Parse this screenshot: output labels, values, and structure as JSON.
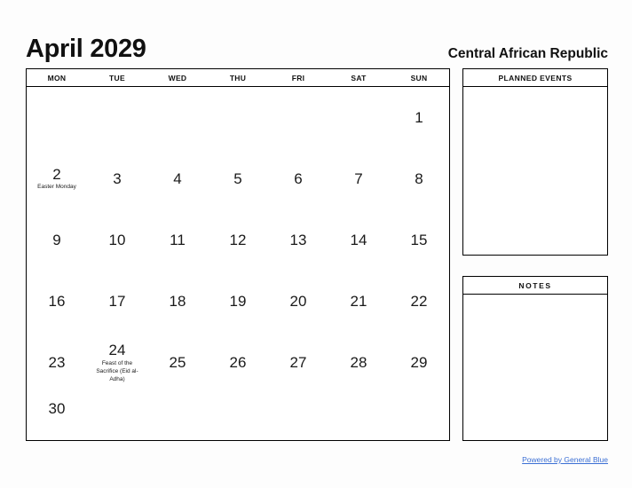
{
  "header": {
    "month_title": "April 2029",
    "region_title": "Central African Republic"
  },
  "calendar": {
    "weekdays": [
      "MON",
      "TUE",
      "WED",
      "THU",
      "FRI",
      "SAT",
      "SUN"
    ],
    "weeks": [
      [
        {
          "day": "",
          "event": ""
        },
        {
          "day": "",
          "event": ""
        },
        {
          "day": "",
          "event": ""
        },
        {
          "day": "",
          "event": ""
        },
        {
          "day": "",
          "event": ""
        },
        {
          "day": "",
          "event": ""
        },
        {
          "day": "1",
          "event": ""
        }
      ],
      [
        {
          "day": "2",
          "event": "Easter Monday"
        },
        {
          "day": "3",
          "event": ""
        },
        {
          "day": "4",
          "event": ""
        },
        {
          "day": "5",
          "event": ""
        },
        {
          "day": "6",
          "event": ""
        },
        {
          "day": "7",
          "event": ""
        },
        {
          "day": "8",
          "event": ""
        }
      ],
      [
        {
          "day": "9",
          "event": ""
        },
        {
          "day": "10",
          "event": ""
        },
        {
          "day": "11",
          "event": ""
        },
        {
          "day": "12",
          "event": ""
        },
        {
          "day": "13",
          "event": ""
        },
        {
          "day": "14",
          "event": ""
        },
        {
          "day": "15",
          "event": ""
        }
      ],
      [
        {
          "day": "16",
          "event": ""
        },
        {
          "day": "17",
          "event": ""
        },
        {
          "day": "18",
          "event": ""
        },
        {
          "day": "19",
          "event": ""
        },
        {
          "day": "20",
          "event": ""
        },
        {
          "day": "21",
          "event": ""
        },
        {
          "day": "22",
          "event": ""
        }
      ],
      [
        {
          "day": "23",
          "event": ""
        },
        {
          "day": "24",
          "event": "Feast of the Sacrifice (Eid al-Adha)"
        },
        {
          "day": "25",
          "event": ""
        },
        {
          "day": "26",
          "event": ""
        },
        {
          "day": "27",
          "event": ""
        },
        {
          "day": "28",
          "event": ""
        },
        {
          "day": "29",
          "event": ""
        }
      ],
      [
        {
          "day": "30",
          "event": ""
        },
        {
          "day": "",
          "event": ""
        },
        {
          "day": "",
          "event": ""
        },
        {
          "day": "",
          "event": ""
        },
        {
          "day": "",
          "event": ""
        },
        {
          "day": "",
          "event": ""
        },
        {
          "day": "",
          "event": ""
        }
      ]
    ]
  },
  "panels": {
    "planned_events_title": "PLANNED EVENTS",
    "notes_title": "NOTES"
  },
  "footer": {
    "link_text": "Powered by General Blue",
    "link_color": "#3b6fd4"
  }
}
